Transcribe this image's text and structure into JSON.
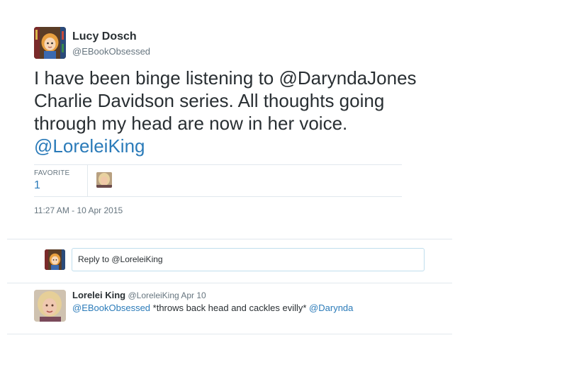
{
  "tweet": {
    "author_name": "Lucy Dosch",
    "author_handle": "@EBookObsessed",
    "text_part1": "I have been binge listening to @DaryndaJones Charlie Davidson series. All thoughts going through my head are now in her voice.",
    "text_mention": "@LoreleiKing",
    "favorite_label": "FAVORITE",
    "favorite_count": "1",
    "timestamp": "11:27 AM - 10 Apr 2015"
  },
  "reply_composer": {
    "placeholder": "Reply to @LoreleiKing"
  },
  "reply": {
    "author_name": "Lorelei King",
    "author_handle": "@LoreleiKing",
    "date": "Apr 10",
    "mention_start": "@EBookObsessed",
    "body": " *throws back head and cackles evilly* ",
    "mention_end": "@Darynda"
  },
  "colors": {
    "link": "#2b7bb9",
    "text": "#292f33",
    "muted": "#66757f",
    "border": "#e1e8ed"
  }
}
